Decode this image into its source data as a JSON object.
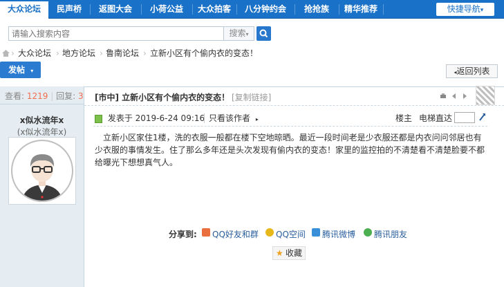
{
  "nav": {
    "items": [
      "大众论坛",
      "民声桥",
      "返图大会",
      "小荷公益",
      "大众拍客",
      "八分钟约会",
      "抢抢族",
      "精华推荐"
    ],
    "quick_nav": "快捷导航"
  },
  "search": {
    "placeholder": "请输入搜索内容",
    "type": "搜索",
    "colors": {
      "button": "#2777cc"
    }
  },
  "breadcrumb": [
    "大众论坛",
    "地方论坛",
    "鲁南论坛",
    "立新小区有个偷内衣的变态！"
  ],
  "toolbar": {
    "post_label": "发帖",
    "return_label": "返回列表"
  },
  "stats": {
    "views_label": "查看:",
    "views": "1219",
    "replies_label": "回复:",
    "replies": "3"
  },
  "author": {
    "name": "x似水流年x",
    "subname": "(x似水流年x)"
  },
  "post": {
    "title": "[市中] 立新小区有个偷内衣的变态！",
    "copy_link": "[复制链接]",
    "date": "发表于 2019-6-24 09:16",
    "only_author": "只看该作者",
    "floor": "楼主",
    "elevator": "电梯直达",
    "content": "立新小区家住1楼，洗的衣服一般都在楼下空地晾晒。最近一段时间老是少衣服还都是内衣问问邻居也有少衣服的事情发生。住了那么多年还是头次发现有偷内衣的变态！家里的监控拍的不清楚看不清楚脸要不都给曝光下想想真气人。"
  },
  "share": {
    "label": "分享到:",
    "links": [
      "QQ好友和群",
      "QQ空间",
      "腾讯微博",
      "腾讯朋友"
    ],
    "favorite": "收藏"
  },
  "colors": {
    "nav_bg": "#1a71c8",
    "accent_num": "#f26c4f",
    "side_bg": "#e5edf2"
  }
}
